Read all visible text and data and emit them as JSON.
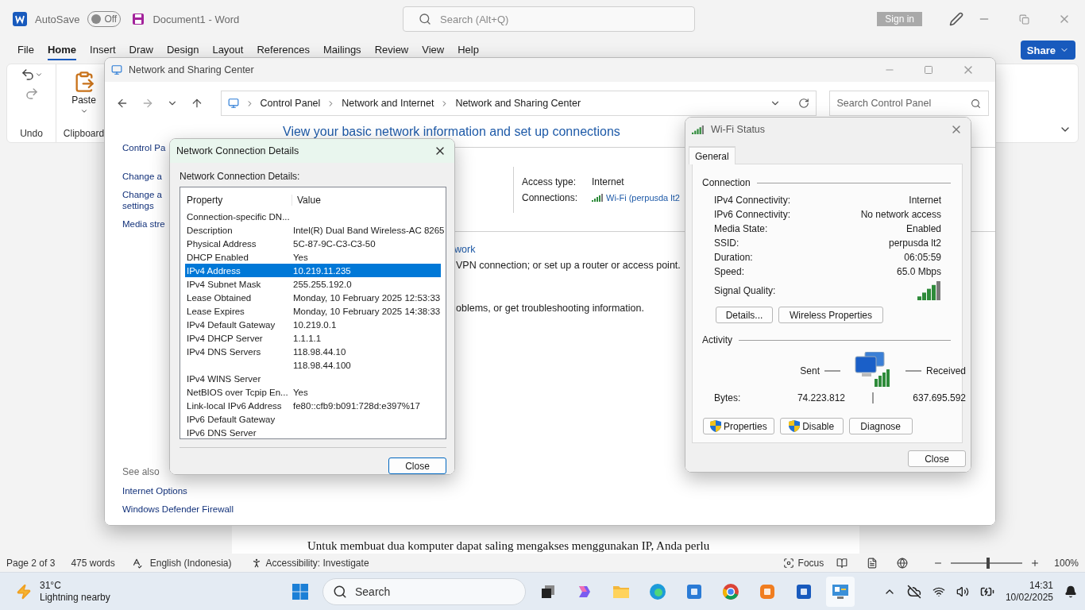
{
  "word": {
    "autosave": {
      "label": "AutoSave",
      "state": "Off",
      "on": false
    },
    "document_title": "Document1  -  Word",
    "search": {
      "placeholder": "Search (Alt+Q)"
    },
    "sign_in": "Sign in",
    "tabs": [
      {
        "label": "File",
        "selected": false
      },
      {
        "label": "Home",
        "selected": true
      },
      {
        "label": "Insert",
        "selected": false
      },
      {
        "label": "Draw",
        "selected": false
      },
      {
        "label": "Design",
        "selected": false
      },
      {
        "label": "Layout",
        "selected": false
      },
      {
        "label": "References",
        "selected": false
      },
      {
        "label": "Mailings",
        "selected": false
      },
      {
        "label": "Review",
        "selected": false
      },
      {
        "label": "View",
        "selected": false
      },
      {
        "label": "Help",
        "selected": false
      }
    ],
    "share": "Share",
    "ribbon": {
      "paste": "Paste",
      "groups": [
        "Undo",
        "Clipboard"
      ]
    },
    "document_text": "Untuk membuat dua komputer dapat saling mengakses menggunakan IP, Anda perlu",
    "status_bar": {
      "page": "Page 2 of 3",
      "words": "475 words",
      "language": "English (Indonesia)",
      "accessibility": "Accessibility: Investigate",
      "focus": "Focus",
      "zoom": "100%",
      "zoom_slider": {
        "level": 0.5
      }
    }
  },
  "control_panel": {
    "title": "Network and Sharing Center",
    "breadcrumb": [
      "Control Panel",
      "Network and Internet",
      "Network and Sharing Center"
    ],
    "search": {
      "placeholder": "Search Control Panel"
    },
    "heading": "View your basic network information and set up connections",
    "sidebar": [
      {
        "lines": [
          "Control Pa"
        ]
      },
      {
        "lines": [
          "Change a"
        ]
      },
      {
        "lines": [
          "Change a",
          "settings"
        ]
      },
      {
        "lines": [
          "Media stre"
        ]
      }
    ],
    "see_also": {
      "label": "See also",
      "links": [
        "Internet Options",
        "Windows Defender Firewall"
      ]
    },
    "access_type": {
      "label": "Access type:",
      "value": "Internet"
    },
    "connections": {
      "label": "Connections:",
      "value": "Wi-Fi (perpusda lt2"
    },
    "fragments": [
      {
        "kind": "link",
        "text": "work"
      },
      {
        "kind": "text",
        "text": "VPN connection; or set up a router or access point."
      },
      {
        "kind": "text",
        "text": "oblems, or get troubleshooting information."
      }
    ]
  },
  "details_dialog": {
    "title": "Network Connection Details",
    "label": "Network Connection Details:",
    "columns": [
      "Property",
      "Value"
    ],
    "rows": [
      {
        "property": "Connection-specific DN...",
        "selected": false
      },
      {
        "property": "Description",
        "value": "Intel(R) Dual Band Wireless-AC 8265",
        "selected": false
      },
      {
        "property": "Physical Address",
        "value": "5C-87-9C-C3-C3-50",
        "selected": false
      },
      {
        "property": "DHCP Enabled",
        "value": "Yes",
        "selected": false
      },
      {
        "property": "IPv4 Address",
        "value": "10.219.11.235",
        "selected": true
      },
      {
        "property": "IPv4 Subnet Mask",
        "value": "255.255.192.0",
        "selected": false
      },
      {
        "property": "Lease Obtained",
        "value": "Monday, 10 February 2025 12:53:33",
        "selected": false
      },
      {
        "property": "Lease Expires",
        "value": "Monday, 10 February 2025 14:38:33",
        "selected": false
      },
      {
        "property": "IPv4 Default Gateway",
        "value": "10.219.0.1",
        "selected": false
      },
      {
        "property": "IPv4 DHCP Server",
        "value": "1.1.1.1",
        "selected": false
      },
      {
        "property": "IPv4 DNS Servers",
        "value": "118.98.44.10",
        "selected": false
      },
      {
        "value": "118.98.44.100",
        "selected": false
      },
      {
        "property": "IPv4 WINS Server",
        "selected": false
      },
      {
        "property": "NetBIOS over Tcpip En...",
        "value": "Yes",
        "selected": false
      },
      {
        "property": "Link-local IPv6 Address",
        "value": "fe80::cfb9:b091:728d:e397%17",
        "selected": false
      },
      {
        "property": "IPv6 Default Gateway",
        "selected": false
      },
      {
        "property": "IPv6 DNS Server",
        "selected": false
      }
    ],
    "close": "Close"
  },
  "wifi_status": {
    "title": "Wi-Fi Status",
    "tabs": [
      {
        "label": "General",
        "selected": true
      }
    ],
    "connection": {
      "label": "Connection",
      "fields": [
        {
          "label": "IPv4 Connectivity:",
          "value": "Internet"
        },
        {
          "label": "IPv6 Connectivity:",
          "value": "No network access"
        },
        {
          "label": "Media State:",
          "value": "Enabled"
        },
        {
          "label": "SSID:",
          "value": "perpusda lt2"
        },
        {
          "label": "Duration:",
          "value": "06:05:59"
        },
        {
          "label": "Speed:",
          "value": "65.0 Mbps"
        }
      ]
    },
    "signal_quality": "Signal Quality:",
    "buttons": [
      "Details...",
      "Wireless Properties"
    ],
    "activity": {
      "label": "Activity",
      "sent": "Sent",
      "received": "Received",
      "bytes_label": "Bytes:",
      "sent_bytes": "74.223.812",
      "received_bytes": "637.695.592"
    },
    "actions": [
      {
        "label": "Properties",
        "shield": true
      },
      {
        "label": "Disable",
        "shield": true
      },
      {
        "label": "Diagnose",
        "shield": false
      }
    ],
    "close": "Close"
  },
  "taskbar": {
    "weather": {
      "temperature": "31°C",
      "condition": "Lightning nearby"
    },
    "search": "Search",
    "time": "14:31",
    "date": "10/02/2025"
  }
}
